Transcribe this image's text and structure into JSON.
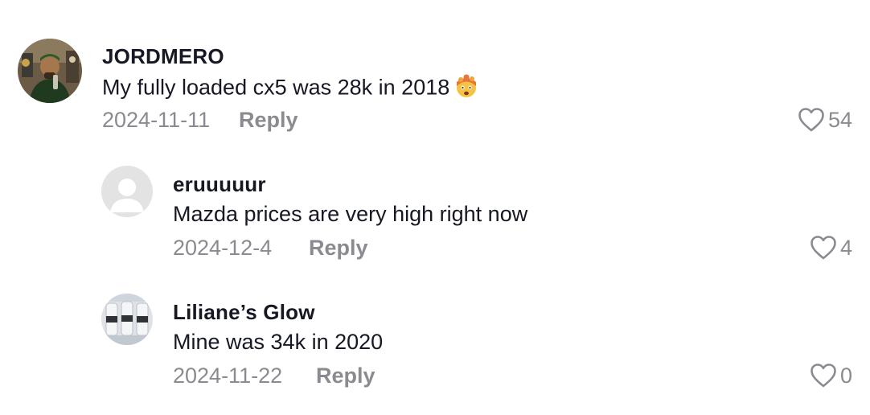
{
  "comments": [
    {
      "username": "JORDMERO",
      "text": "My fully loaded cx5 was 28k in 2018",
      "emoji": "exploding-head-emoji",
      "date": "2024-11-11",
      "reply_label": "Reply",
      "likes": "54"
    },
    {
      "username": "eruuuuur",
      "text": "Mazda prices are very high right now",
      "date": "2024-12-4",
      "reply_label": "Reply",
      "likes": "4"
    },
    {
      "username": "Liliane’s Glow",
      "text": "Mine was 34k in 2020",
      "date": "2024-11-22",
      "reply_label": "Reply",
      "likes": "0"
    }
  ],
  "colors": {
    "text_primary": "#161823",
    "text_secondary": "#8a8b91",
    "placeholder_avatar": "#e3e3e4"
  }
}
